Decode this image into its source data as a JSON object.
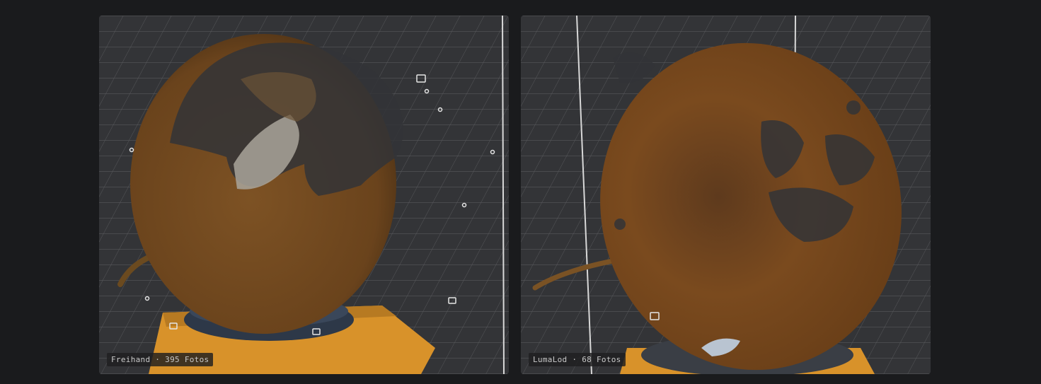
{
  "gallery": {
    "items": [
      {
        "caption": "Freihand · 395 Fotos"
      },
      {
        "caption": "LumaLod · 68 Fotos"
      }
    ]
  },
  "colors": {
    "background": "#1a1b1d",
    "viewport": "#333437",
    "grid": "#5a5b5e",
    "copper": "#7a4f22",
    "copper_dark": "#5b3a18",
    "base_orange": "#e09a2a",
    "base_blue": "#2e3a4a"
  }
}
